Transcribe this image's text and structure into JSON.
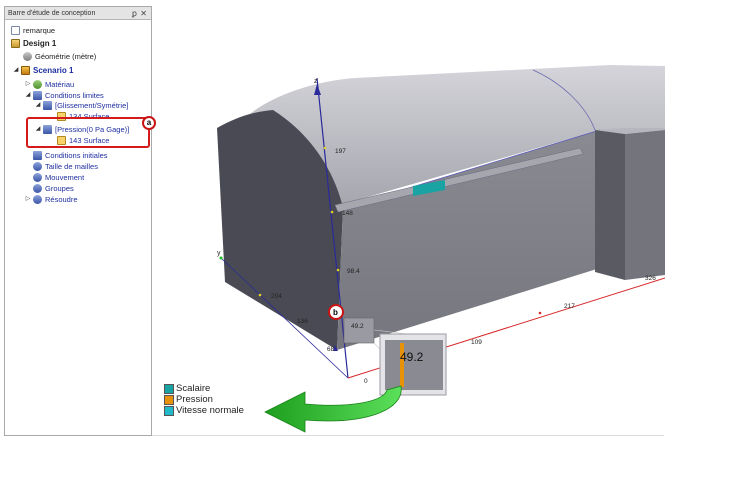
{
  "panel": {
    "title": "Barre d'étude de conception",
    "pin_glyph": "ꝑ",
    "close_glyph": "✕"
  },
  "tree": {
    "remarque": "remarque",
    "design": "Design 1",
    "geometrie": "Géométrie (mètre)",
    "scenario": "Scenario 1",
    "materiau": "Matériau",
    "conditions_limites": "Conditions limites",
    "glissement": "[Glissement/Symétrie]",
    "surface_134": "134 Surface",
    "pression": "[Pression(0 Pa Gage)]",
    "surface_143": "143 Surface",
    "conditions_initiales": "Conditions initiales",
    "taille_mailles": "Taille de mailles",
    "mouvement": "Mouvement",
    "groupes": "Groupes",
    "resoudre": "Résoudre"
  },
  "callouts": {
    "a": "a",
    "b": "b"
  },
  "axes": {
    "z": "z",
    "y": "y"
  },
  "dimensions": {
    "d197": "197",
    "d148": "148",
    "d98": "98.4",
    "d49": "49.2",
    "d68": "68",
    "d0": "0",
    "d136": "136",
    "d204": "204",
    "d109": "109",
    "d217": "217",
    "d326": "326"
  },
  "zoom_value": "49.2",
  "legend": [
    {
      "label": "Scalaire",
      "color": "#1aa3a3"
    },
    {
      "label": "Pression",
      "color": "#e8920c"
    },
    {
      "label": "Vitesse normale",
      "color": "#22b8c8"
    }
  ],
  "colors": {
    "highlight": "#d41a1a",
    "arrow": "#3cc83c",
    "axis": "#2a2a9a",
    "measure": "#d62828"
  }
}
